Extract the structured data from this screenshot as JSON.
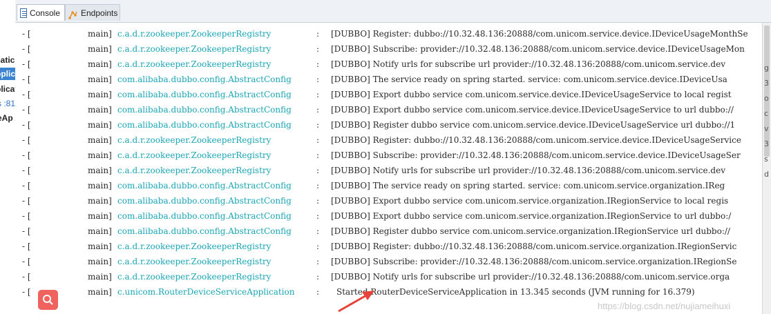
{
  "left_pane": {
    "items": [
      {
        "label": "catic"
      },
      {
        "label": "pplic"
      },
      {
        "label": "plicat"
      },
      {
        "label": "s :81"
      },
      {
        "label": "eAp"
      }
    ]
  },
  "tabs": [
    {
      "label": "Console",
      "icon": "console-icon",
      "active": true
    },
    {
      "label": "Endpoints",
      "icon": "endpoints-icon",
      "active": false
    }
  ],
  "console": {
    "lines": [
      {
        "prefix": "- [",
        "thread": "main]",
        "logger": "c.a.d.r.zookeeper.ZookeeperRegistry",
        "sep": ":",
        "message": "[DUBBO] Register: dubbo://10.32.48.136:20888/com.unicom.service.device.IDeviceUsageMonthSe"
      },
      {
        "prefix": "- [",
        "thread": "main]",
        "logger": "c.a.d.r.zookeeper.ZookeeperRegistry",
        "sep": ":",
        "message": "[DUBBO] Subscribe: provider://10.32.48.136:20888/com.unicom.service.device.IDeviceUsageMon"
      },
      {
        "prefix": "- [",
        "thread": "main]",
        "logger": "c.a.d.r.zookeeper.ZookeeperRegistry",
        "sep": ":",
        "message": "[DUBBO] Notify urls for subscribe url provider://10.32.48.136:20888/com.unicom.service.dev"
      },
      {
        "prefix": "- [",
        "thread": "main]",
        "logger": "com.alibaba.dubbo.config.AbstractConfig",
        "sep": ":",
        "message": "[DUBBO] The service ready on spring started. service: com.unicom.service.device.IDeviceUsa"
      },
      {
        "prefix": "- [",
        "thread": "main]",
        "logger": "com.alibaba.dubbo.config.AbstractConfig",
        "sep": ":",
        "message": "[DUBBO] Export dubbo service com.unicom.service.device.IDeviceUsageService to local regist"
      },
      {
        "prefix": "- [",
        "thread": "main]",
        "logger": "com.alibaba.dubbo.config.AbstractConfig",
        "sep": ":",
        "message": "[DUBBO] Export dubbo service com.unicom.service.device.IDeviceUsageService to url dubbo://"
      },
      {
        "prefix": "- [",
        "thread": "main]",
        "logger": "com.alibaba.dubbo.config.AbstractConfig",
        "sep": ":",
        "message": "[DUBBO] Register dubbo service com.unicom.service.device.IDeviceUsageService url dubbo://1"
      },
      {
        "prefix": "- [",
        "thread": "main]",
        "logger": "c.a.d.r.zookeeper.ZookeeperRegistry",
        "sep": ":",
        "message": "[DUBBO] Register: dubbo://10.32.48.136:20888/com.unicom.service.device.IDeviceUsageService"
      },
      {
        "prefix": "- [",
        "thread": "main]",
        "logger": "c.a.d.r.zookeeper.ZookeeperRegistry",
        "sep": ":",
        "message": "[DUBBO] Subscribe: provider://10.32.48.136:20888/com.unicom.service.device.IDeviceUsageSer"
      },
      {
        "prefix": "- [",
        "thread": "main]",
        "logger": "c.a.d.r.zookeeper.ZookeeperRegistry",
        "sep": ":",
        "message": "[DUBBO] Notify urls for subscribe url provider://10.32.48.136:20888/com.unicom.service.dev"
      },
      {
        "prefix": "- [",
        "thread": "main]",
        "logger": "com.alibaba.dubbo.config.AbstractConfig",
        "sep": ":",
        "message": "[DUBBO] The service ready on spring started. service: com.unicom.service.organization.IReg"
      },
      {
        "prefix": "- [",
        "thread": "main]",
        "logger": "com.alibaba.dubbo.config.AbstractConfig",
        "sep": ":",
        "message": "[DUBBO] Export dubbo service com.unicom.service.organization.IRegionService to local regis"
      },
      {
        "prefix": "- [",
        "thread": "main]",
        "logger": "com.alibaba.dubbo.config.AbstractConfig",
        "sep": ":",
        "message": "[DUBBO] Export dubbo service com.unicom.service.organization.IRegionService to url dubbo:/"
      },
      {
        "prefix": "- [",
        "thread": "main]",
        "logger": "com.alibaba.dubbo.config.AbstractConfig",
        "sep": ":",
        "message": "[DUBBO] Register dubbo service com.unicom.service.organization.IRegionService url dubbo://"
      },
      {
        "prefix": "- [",
        "thread": "main]",
        "logger": "c.a.d.r.zookeeper.ZookeeperRegistry",
        "sep": ":",
        "message": "[DUBBO] Register: dubbo://10.32.48.136:20888/com.unicom.service.organization.IRegionServic"
      },
      {
        "prefix": "- [",
        "thread": "main]",
        "logger": "c.a.d.r.zookeeper.ZookeeperRegistry",
        "sep": ":",
        "message": "[DUBBO] Subscribe: provider://10.32.48.136:20888/com.unicom.service.organization.IRegionSe"
      },
      {
        "prefix": "- [",
        "thread": "main]",
        "logger": "c.a.d.r.zookeeper.ZookeeperRegistry",
        "sep": ":",
        "message": "[DUBBO] Notify urls for subscribe url provider://10.32.48.136:20888/com.unicom.service.orga"
      }
    ],
    "final_line": {
      "prefix": "- [",
      "thread": "main]",
      "logger": "c.unicom.RouterDeviceServiceApplication",
      "sep": ":",
      "message": "Started RouterDeviceServiceApplication in 13.345 seconds (JVM running for 16.379)"
    }
  },
  "scrollbar_glyphs": [
    "g",
    "3",
    "o",
    "c",
    "v",
    "3",
    "s",
    "d"
  ],
  "overlay": {
    "search_badge_icon": "search-icon",
    "arrow_color": "#e8433a",
    "watermark": "https://blog.csdn.net/nujiameihuxi"
  },
  "colors": {
    "logger": "#1aa5b5",
    "tab_active_bg": "#ffffff",
    "selection": "#3a83d0"
  }
}
